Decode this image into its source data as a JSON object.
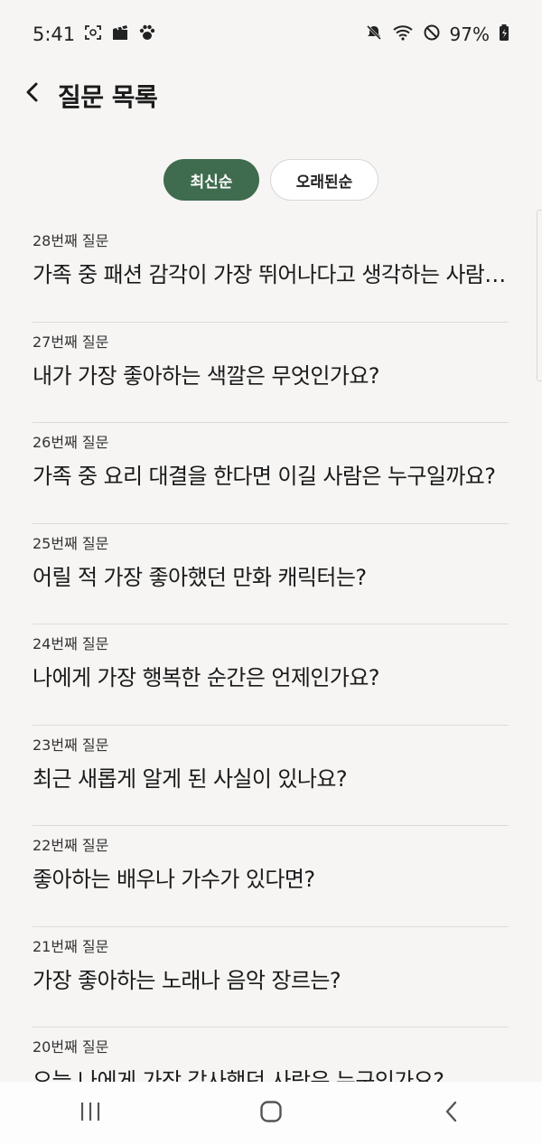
{
  "status_bar": {
    "time": "5:41",
    "battery": "97%",
    "left_icons": [
      "screenshot-icon",
      "clapper-icon",
      "paw-icon"
    ],
    "right_icons": [
      "mute-icon",
      "wifi-icon",
      "dnd-icon",
      "battery-icon"
    ]
  },
  "header": {
    "title": "질문 목록",
    "back_icon": "chevron-left-icon"
  },
  "sort": {
    "latest_label": "최신순",
    "oldest_label": "오래된순",
    "active": "latest",
    "active_color": "#3f6b4e"
  },
  "questions": [
    {
      "number": "28번째 질문",
      "text": "가족 중 패션 감각이 가장 뛰어나다고 생각하는 사람은 누구인가요?"
    },
    {
      "number": "27번째 질문",
      "text": "내가 가장 좋아하는 색깔은 무엇인가요?"
    },
    {
      "number": "26번째 질문",
      "text": "가족 중 요리 대결을 한다면 이길 사람은 누구일까요?"
    },
    {
      "number": "25번째 질문",
      "text": "어릴 적 가장 좋아했던 만화 캐릭터는?"
    },
    {
      "number": "24번째 질문",
      "text": "나에게 가장 행복한 순간은 언제인가요?"
    },
    {
      "number": "23번째 질문",
      "text": "최근 새롭게 알게 된 사실이 있나요?"
    },
    {
      "number": "22번째 질문",
      "text": "좋아하는 배우나 가수가 있다면?"
    },
    {
      "number": "21번째 질문",
      "text": "가장 좋아하는 노래나 음악 장르는?"
    },
    {
      "number": "20번째 질문",
      "text": "오늘 나에게 가장 감사했던 사람은 누구인가요?"
    }
  ],
  "nav_bar": {
    "icons": [
      "recent-apps-icon",
      "home-icon",
      "back-icon"
    ]
  }
}
